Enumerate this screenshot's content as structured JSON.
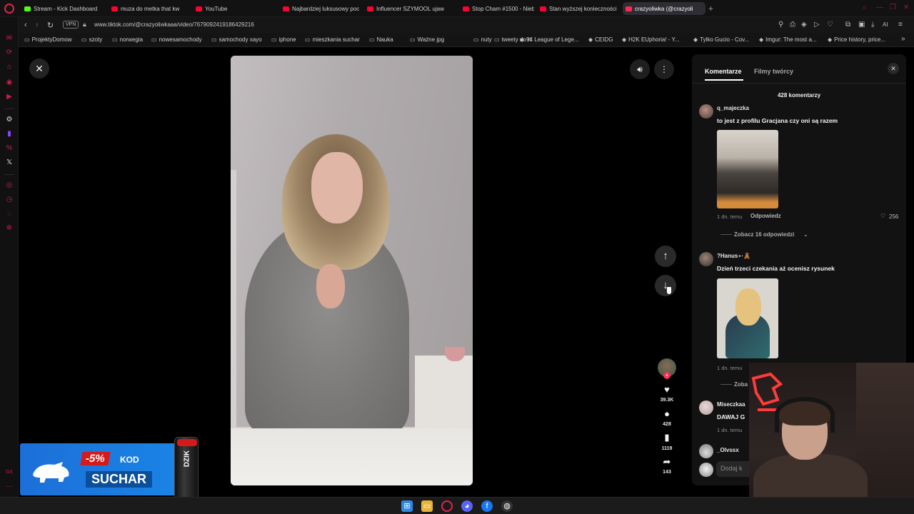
{
  "browser": {
    "tabs": [
      {
        "label": "Stream - Kick Dashboard",
        "color": "#53fc18"
      },
      {
        "label": "muza do metka that kw",
        "color": "#ff0033"
      },
      {
        "label": "YouTube",
        "color": "#ff0033"
      },
      {
        "label": "Najbardziej luksusowy poc",
        "color": "#ff0033"
      },
      {
        "label": "Influencer SZYMOOL ujaw",
        "color": "#ff0033"
      },
      {
        "label": "Stop Cham #1500 - Niebe",
        "color": "#ff0033"
      },
      {
        "label": "Stan wyższej konieczności",
        "color": "#ff0033"
      },
      {
        "label": "crazyoliwka (@crazyoli",
        "color": "#fe2c55",
        "active": true
      }
    ],
    "new_tab": "+",
    "url": "www.tiktok.com/@crazyoliwkaaa/video/7679092419186429216",
    "vpn_label": "VPN",
    "ai_label": "AI",
    "bookmarks": [
      "ProjektyDomow",
      "szoty",
      "norwegia",
      "nowesamochody",
      "samochody xayo",
      "iphone",
      "mieszkania suchar",
      "Nauka",
      "Ważne jpg",
      "nuty",
      "tweety do rt",
      "94 League of Lege...",
      "CEIDG",
      "H2K EUphoria! - Y...",
      "Tylko Gucio - Cov...",
      "Imgur: The most a...",
      "Price history, price..."
    ]
  },
  "video": {
    "stats": {
      "likes": "39.3K",
      "comments": "428",
      "saves": "1119",
      "shares": "143"
    }
  },
  "panel": {
    "tabs": {
      "comments": "Komentarze",
      "creator_videos": "Filmy twórcy"
    },
    "count_label": "428 komentarzy",
    "comments": [
      {
        "user": "q_majeczka",
        "text": "to jest z profilu Gracjana czy oni są razem",
        "time": "1 dn. temu",
        "reply": "Odpowiedz",
        "likes": "256",
        "more_replies": "Zobacz 16 odpowiedzi"
      },
      {
        "user": "?Hanus⋆·🧸",
        "text": "Dzień trzeci czekania aż ocenisz rysunek",
        "time": "1 dn. temu",
        "more_replies": "Zoba"
      },
      {
        "user": "Miseczkaa",
        "text": "DAWAJ G",
        "time": "1 dn. temu"
      },
      {
        "user": "_Olvssx"
      }
    ],
    "input_placeholder": "Dodaj k"
  },
  "ad": {
    "discount": "-5%",
    "kod": "KOD",
    "code": "SUCHAR",
    "brand": "DZIK"
  },
  "colors": {
    "opera_red": "#e0244f",
    "tiktok_red": "#fe2c55",
    "panel_bg": "#121212"
  }
}
